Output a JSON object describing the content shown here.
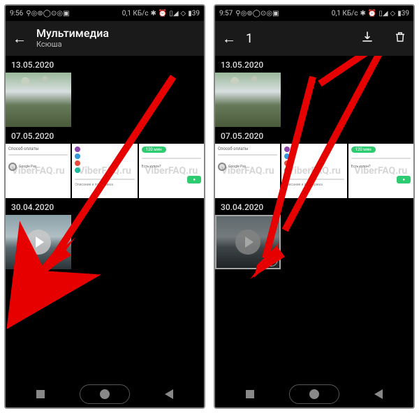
{
  "statusbar": {
    "time_left": "9:56",
    "time_right": "9:57",
    "speed": "0,1 КБ/с",
    "battery": "39"
  },
  "left": {
    "header_title": "Мультимедиа",
    "header_subtitle": "Ксюша",
    "dates": [
      "13.05.2020",
      "07.05.2020",
      "30.04.2020"
    ],
    "card_time": "120 мин",
    "watermark": "ViberFAQ.ru"
  },
  "right": {
    "selection_count": "1",
    "dates": [
      "13.05.2020",
      "07.05.2020",
      "30.04.2020"
    ],
    "card_time": "120 мин",
    "watermark": "ViberFAQ.ru"
  }
}
